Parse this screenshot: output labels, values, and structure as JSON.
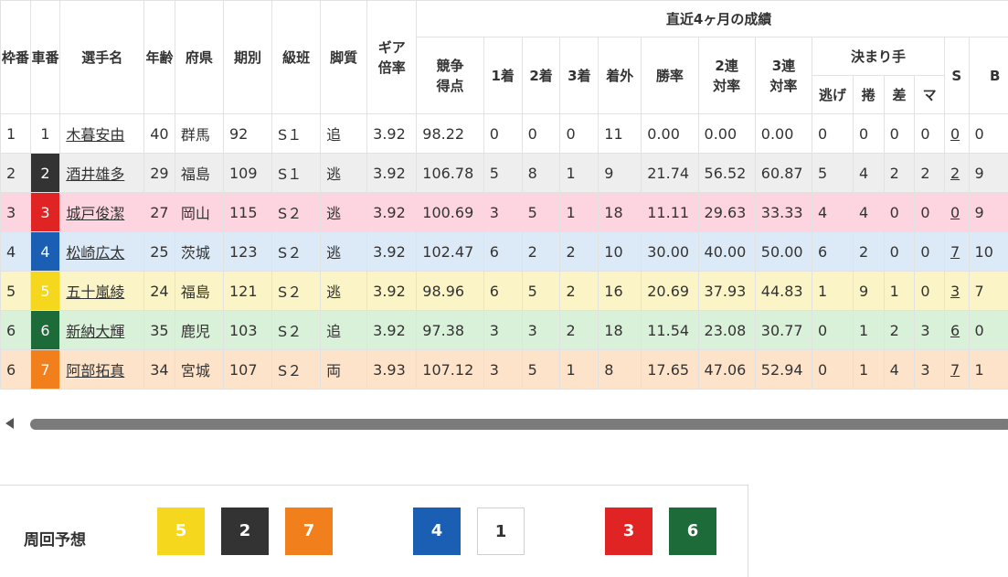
{
  "table": {
    "headers": {
      "waku": "枠番",
      "sha": "車番",
      "name": "選手名",
      "age": "年齢",
      "pref": "府県",
      "term": "期別",
      "class": "級班",
      "style": "脚質",
      "gear": "ギア倍率",
      "recent_group": "直近4ヶ月の成績",
      "score": "競争得点",
      "first": "1着",
      "second": "2着",
      "third": "3着",
      "out": "着外",
      "win_rate": "勝率",
      "rate2": "2連対率",
      "rate3": "3連対率",
      "kimarite": "決まり手",
      "nige": "逃げ",
      "makuri": "捲",
      "sashi": "差",
      "mark": "マ",
      "s": "S",
      "b": "B"
    },
    "rows": [
      {
        "waku": "1",
        "car": "1",
        "name": "木暮安由",
        "age": "40",
        "pref": "群馬",
        "term": "92",
        "class": "S１",
        "style": "追",
        "gear": "3.92",
        "score": "98.22",
        "first": "0",
        "second": "0",
        "third": "0",
        "out": "11",
        "win_rate": "0.00",
        "rate2": "0.00",
        "rate3": "0.00",
        "nige": "0",
        "makuri": "0",
        "sashi": "0",
        "mark": "0",
        "s": "0",
        "b": "0"
      },
      {
        "waku": "2",
        "car": "2",
        "name": "酒井雄多",
        "age": "29",
        "pref": "福島",
        "term": "109",
        "class": "S１",
        "style": "逃",
        "gear": "3.92",
        "score": "106.78",
        "first": "5",
        "second": "8",
        "third": "1",
        "out": "9",
        "win_rate": "21.74",
        "rate2": "56.52",
        "rate3": "60.87",
        "nige": "5",
        "makuri": "4",
        "sashi": "2",
        "mark": "2",
        "s": "2",
        "b": "9"
      },
      {
        "waku": "3",
        "car": "3",
        "name": "城戸俊潔",
        "age": "27",
        "pref": "岡山",
        "term": "115",
        "class": "S２",
        "style": "逃",
        "gear": "3.92",
        "score": "100.69",
        "first": "3",
        "second": "5",
        "third": "1",
        "out": "18",
        "win_rate": "11.11",
        "rate2": "29.63",
        "rate3": "33.33",
        "nige": "4",
        "makuri": "4",
        "sashi": "0",
        "mark": "0",
        "s": "0",
        "b": "9"
      },
      {
        "waku": "4",
        "car": "4",
        "name": "松崎広太",
        "age": "25",
        "pref": "茨城",
        "term": "123",
        "class": "S２",
        "style": "逃",
        "gear": "3.92",
        "score": "102.47",
        "first": "6",
        "second": "2",
        "third": "2",
        "out": "10",
        "win_rate": "30.00",
        "rate2": "40.00",
        "rate3": "50.00",
        "nige": "6",
        "makuri": "2",
        "sashi": "0",
        "mark": "0",
        "s": "7",
        "b": "10"
      },
      {
        "waku": "5",
        "car": "5",
        "name": "五十嵐綾",
        "age": "24",
        "pref": "福島",
        "term": "121",
        "class": "S２",
        "style": "逃",
        "gear": "3.92",
        "score": "98.96",
        "first": "6",
        "second": "5",
        "third": "2",
        "out": "16",
        "win_rate": "20.69",
        "rate2": "37.93",
        "rate3": "44.83",
        "nige": "1",
        "makuri": "9",
        "sashi": "1",
        "mark": "0",
        "s": "3",
        "b": "7"
      },
      {
        "waku": "6",
        "car": "6",
        "name": "新納大輝",
        "age": "35",
        "pref": "鹿児",
        "term": "103",
        "class": "S２",
        "style": "追",
        "gear": "3.92",
        "score": "97.38",
        "first": "3",
        "second": "3",
        "third": "2",
        "out": "18",
        "win_rate": "11.54",
        "rate2": "23.08",
        "rate3": "30.77",
        "nige": "0",
        "makuri": "1",
        "sashi": "2",
        "mark": "3",
        "s": "6",
        "b": "0"
      },
      {
        "waku": "6",
        "car": "7",
        "name": "阿部拓真",
        "age": "34",
        "pref": "宮城",
        "term": "107",
        "class": "S２",
        "style": "両",
        "gear": "3.93",
        "score": "107.12",
        "first": "3",
        "second": "5",
        "third": "1",
        "out": "8",
        "win_rate": "17.65",
        "rate2": "47.06",
        "rate3": "52.94",
        "nige": "0",
        "makuri": "1",
        "sashi": "4",
        "mark": "3",
        "s": "7",
        "b": "1"
      }
    ]
  },
  "car_colors": {
    "1": {
      "bg": "#ffffff",
      "fg": "#333333"
    },
    "2": {
      "bg": "#333333",
      "fg": "#ffffff"
    },
    "3": {
      "bg": "#e02424",
      "fg": "#ffffff"
    },
    "4": {
      "bg": "#1a5fb4",
      "fg": "#ffffff"
    },
    "5": {
      "bg": "#f5d81d",
      "fg": "#ffffff"
    },
    "6": {
      "bg": "#1e6b3a",
      "fg": "#ffffff"
    },
    "7": {
      "bg": "#f07f1c",
      "fg": "#ffffff"
    }
  },
  "yoso": {
    "label": "周回予想",
    "lineup": [
      "5",
      "2",
      "7",
      "4",
      "1",
      "3",
      "6"
    ]
  }
}
